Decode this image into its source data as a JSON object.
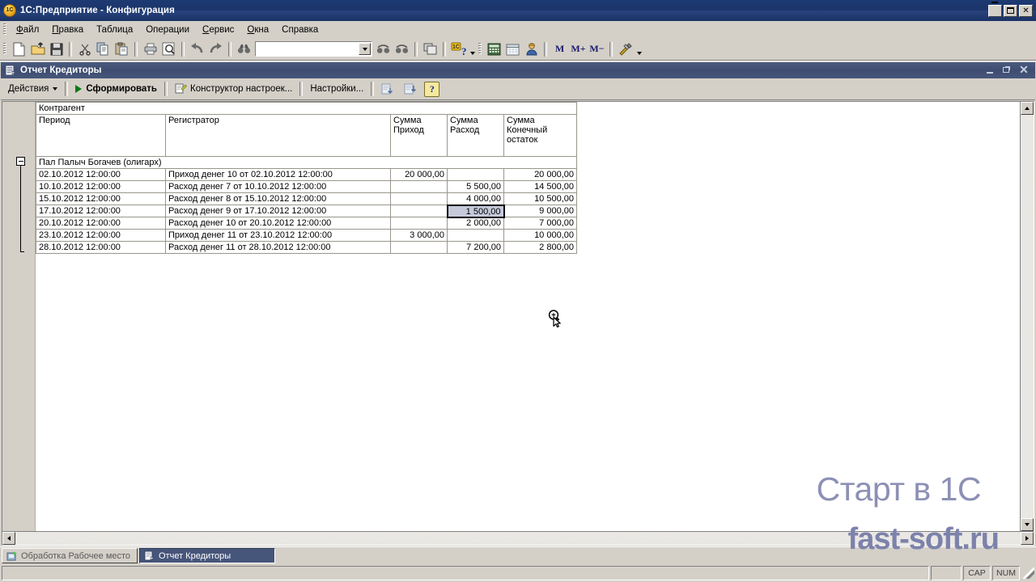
{
  "window": {
    "title": "1С:Предприятие - Конфигурация",
    "icon": "1c-logo-icon",
    "minimize_label": "_",
    "maximize_label": "□",
    "close_label": "✕"
  },
  "menu": {
    "items": [
      {
        "label": "Файл",
        "accel": "Ф"
      },
      {
        "label": "Правка",
        "accel": "П"
      },
      {
        "label": "Таблица",
        "accel": "Т"
      },
      {
        "label": "Операции",
        "accel": "О"
      },
      {
        "label": "Сервис",
        "accel": "С"
      },
      {
        "label": "Окна",
        "accel": "О"
      },
      {
        "label": "Справка",
        "accel": "п"
      }
    ]
  },
  "toolbar": {
    "buttons": [
      {
        "name": "new-document-icon",
        "tip": "Новый"
      },
      {
        "name": "open-folder-icon",
        "tip": "Открыть"
      },
      {
        "name": "save-disk-icon",
        "tip": "Сохранить"
      },
      {
        "name": "cut-scissors-icon",
        "tip": "Вырезать"
      },
      {
        "name": "copy-icon",
        "tip": "Копировать"
      },
      {
        "name": "paste-icon",
        "tip": "Вставить"
      },
      {
        "name": "print-icon",
        "tip": "Печать"
      },
      {
        "name": "print-preview-icon",
        "tip": "Предварительный просмотр"
      },
      {
        "name": "undo-icon",
        "tip": "Отменить"
      },
      {
        "name": "redo-icon",
        "tip": "Вернуть"
      },
      {
        "name": "find-binoculars-icon",
        "tip": "Поиск"
      }
    ],
    "search_value": "",
    "search_placeholder": "",
    "after_buttons": [
      {
        "name": "find-next-icon",
        "tip": "Найти далее"
      },
      {
        "name": "find-prev-icon",
        "tip": "Найти ранее"
      },
      {
        "name": "windows-cascade-icon",
        "tip": "Окна"
      },
      {
        "name": "1c-help-icon",
        "tip": "Справка"
      },
      {
        "name": "calculator-icon",
        "tip": "Калькулятор"
      },
      {
        "name": "calendar-icon",
        "tip": "Календарь"
      },
      {
        "name": "user-admin-icon",
        "tip": "Активные пользователи"
      }
    ],
    "memory_buttons": [
      {
        "label": "M",
        "name": "memory-recall-button"
      },
      {
        "label": "M+",
        "name": "memory-add-button"
      },
      {
        "label": "M−",
        "name": "memory-subtract-button"
      }
    ],
    "tools_icon": "tools-hammer-wrench-icon"
  },
  "child_window": {
    "title": "Отчет  Кредиторы",
    "icon": "report-document-icon",
    "minimize_label": "_",
    "restore_label": "❐",
    "close_label": "✕"
  },
  "actions_bar": {
    "actions_label": "Действия",
    "generate_label": "Сформировать",
    "constructor_label": "Конструктор настроек...",
    "settings_label": "Настройки...",
    "icon_buttons": [
      {
        "name": "save-settings-icon"
      },
      {
        "name": "restore-settings-icon"
      }
    ],
    "help_label": "?"
  },
  "report": {
    "group_header": "Контрагент",
    "columns": [
      {
        "id": "period",
        "label": "Период"
      },
      {
        "id": "registrar",
        "label": "Регистратор"
      },
      {
        "id": "income",
        "label": "Сумма\nПриход"
      },
      {
        "id": "expense",
        "label": "Сумма\nРасход"
      },
      {
        "id": "balance",
        "label": "Сумма\nКонечный\nостаток"
      }
    ],
    "column_labels": {
      "period": "Период",
      "registrar": "Регистратор",
      "income_l1": "Сумма",
      "income_l2": "Приход",
      "expense_l1": "Сумма",
      "expense_l2": "Расход",
      "balance_l1": "Сумма",
      "balance_l2": "Конечный",
      "balance_l3": "остаток"
    },
    "group_name": "Пал Палыч Богачев (олигарх)",
    "rows": [
      {
        "period": "02.10.2012 12:00:00",
        "registrar": "Приход денег 10 от 02.10.2012 12:00:00",
        "income": "20 000,00",
        "expense": "",
        "balance": "20 000,00"
      },
      {
        "period": "10.10.2012 12:00:00",
        "registrar": "Расход денег 7 от 10.10.2012 12:00:00",
        "income": "",
        "expense": "5 500,00",
        "balance": "14 500,00"
      },
      {
        "period": "15.10.2012 12:00:00",
        "registrar": "Расход денег 8 от 15.10.2012 12:00:00",
        "income": "",
        "expense": "4 000,00",
        "balance": "10 500,00"
      },
      {
        "period": "17.10.2012 12:00:00",
        "registrar": "Расход денег 9 от 17.10.2012 12:00:00",
        "income": "",
        "expense": "1 500,00",
        "balance": "9 000,00"
      },
      {
        "period": "20.10.2012 12:00:00",
        "registrar": "Расход денег 10 от 20.10.2012 12:00:00",
        "income": "",
        "expense": "2 000,00",
        "balance": "7 000,00"
      },
      {
        "period": "23.10.2012 12:00:00",
        "registrar": "Приход денег 11 от 23.10.2012 12:00:00",
        "income": "3 000,00",
        "expense": "",
        "balance": "10 000,00"
      },
      {
        "period": "28.10.2012 12:00:00",
        "registrar": "Расход денег 11 от 28.10.2012 12:00:00",
        "income": "",
        "expense": "7 200,00",
        "balance": "2 800,00"
      }
    ],
    "selected_cell": {
      "row_index": 3,
      "column": "expense",
      "value": "1 500,00"
    },
    "group_collapse_state": "expanded"
  },
  "watermark": {
    "line1": "Старт в 1С",
    "line2": "fast-soft.ru"
  },
  "taskbar": {
    "items": [
      {
        "label": "Обработка  Рабочее место",
        "active": false,
        "icon": "processing-icon"
      },
      {
        "label": "Отчет  Кредиторы",
        "active": true,
        "icon": "report-document-icon"
      }
    ]
  },
  "statusbar": {
    "message": "",
    "indicators": [
      {
        "label": "CAP",
        "name": "caps-lock-indicator"
      },
      {
        "label": "NUM",
        "name": "num-lock-indicator"
      }
    ]
  },
  "colors": {
    "title_bar": "#1b3569",
    "child_title_bar": "#46557a",
    "face": "#d4d0c8",
    "header_cell": "#c0c0c0",
    "group_row": "#ebebeb",
    "selection": "#c5c9da",
    "watermark": "#8c90b4",
    "play_green": "#0a7a14"
  }
}
